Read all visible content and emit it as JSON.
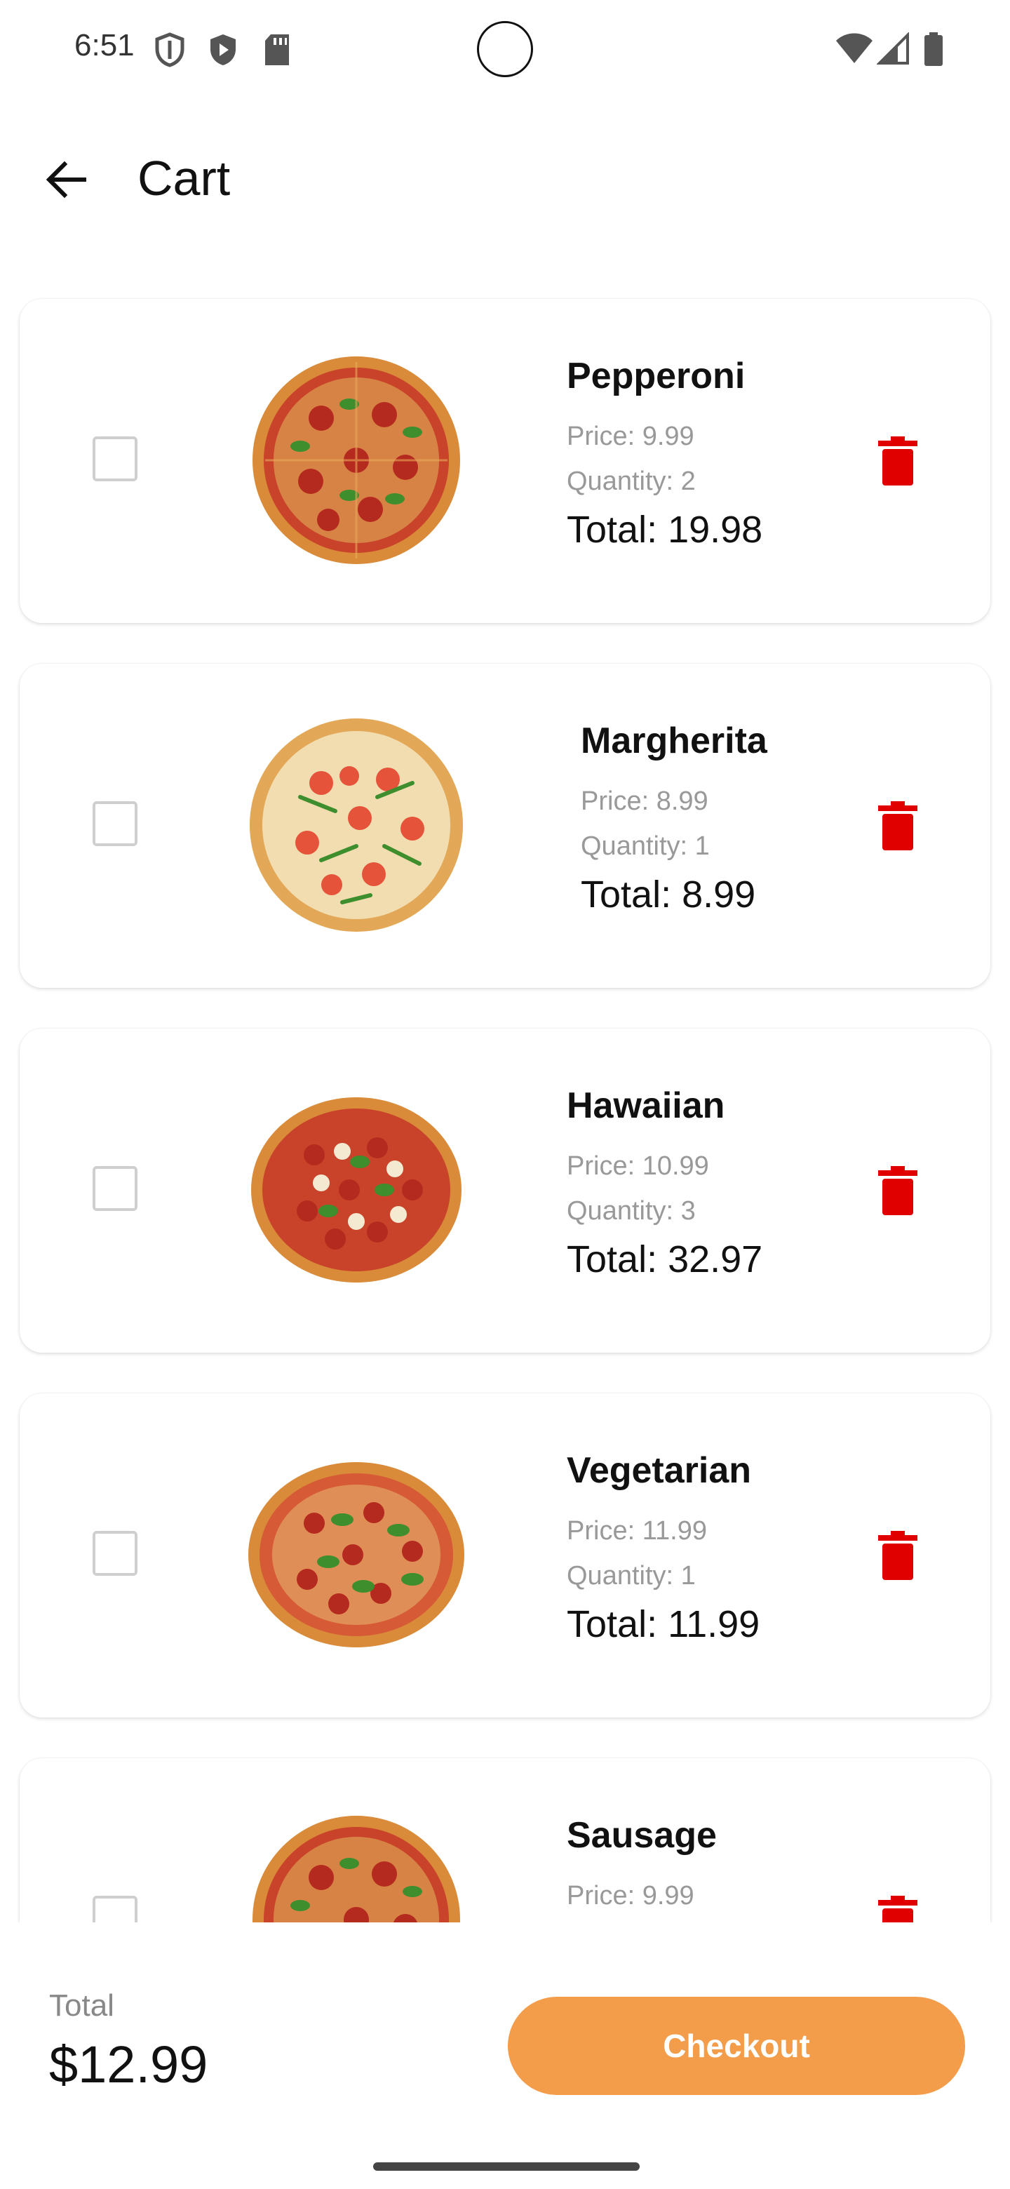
{
  "status_bar": {
    "time": "6:51"
  },
  "app_bar": {
    "title": "Cart"
  },
  "colors": {
    "accent": "#F39C4A",
    "delete": "#E00000",
    "muted_text": "#999999"
  },
  "cart_items": [
    {
      "name": "Pepperoni",
      "price": "Price: 9.99",
      "quantity": "Quantity: 2",
      "total": "Total: 19.98",
      "image_icon": "pepperoni-pizza-image"
    },
    {
      "name": "Margherita",
      "price": "Price: 8.99",
      "quantity": "Quantity: 1",
      "total": "Total: 8.99",
      "image_icon": "margherita-pizza-image"
    },
    {
      "name": "Hawaiian",
      "price": "Price: 10.99",
      "quantity": "Quantity: 3",
      "total": "Total: 32.97",
      "image_icon": "hawaiian-pizza-image"
    },
    {
      "name": "Vegetarian",
      "price": "Price: 11.99",
      "quantity": "Quantity: 1",
      "total": "Total: 11.99",
      "image_icon": "vegetarian-pizza-image"
    },
    {
      "name": "Sausage",
      "price": "Price: 9.99",
      "quantity": "",
      "total": "",
      "image_icon": "sausage-pizza-image"
    }
  ],
  "summary": {
    "label": "Total",
    "value": "$12.99",
    "checkout_label": "Checkout"
  }
}
